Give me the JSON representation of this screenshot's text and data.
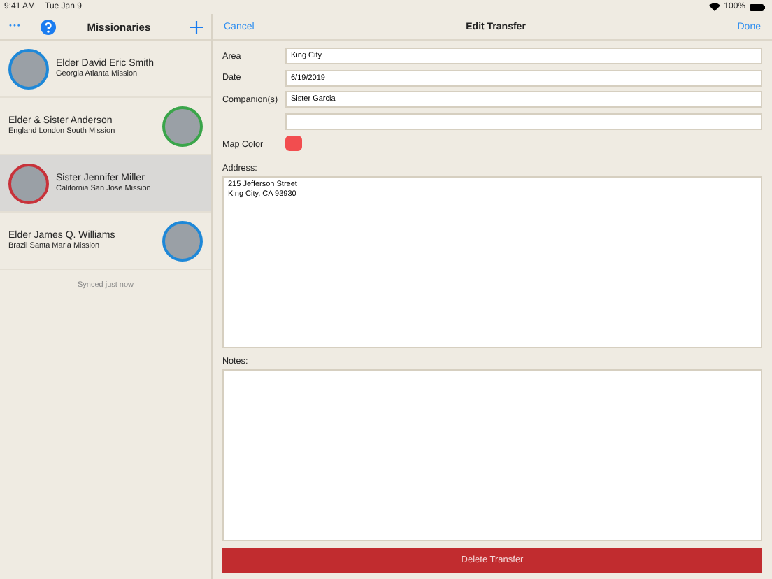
{
  "status_bar": {
    "time": "9:41 AM",
    "date": "Tue Jan 9",
    "battery": "100%"
  },
  "sidebar": {
    "title": "Missionaries",
    "more_icon": "•••",
    "items": [
      {
        "name": "Elder David Eric Smith",
        "mission": "Georgia Atlanta Mission",
        "kind": "left",
        "color": "#1e88d8",
        "selected": false
      },
      {
        "name": "Elder & Sister Anderson",
        "mission": "England London South Mission",
        "kind": "right",
        "color": "#3aa54a",
        "selected": false
      },
      {
        "name": "Sister Jennifer Miller",
        "mission": "California San Jose Mission",
        "kind": "left",
        "color": "#c8323a",
        "selected": true
      },
      {
        "name": "Elder James Q. Williams",
        "mission": "Brazil Santa Maria Mission",
        "kind": "right",
        "color": "#1e88d8",
        "selected": false
      }
    ],
    "sync_status": "Synced just now"
  },
  "editor": {
    "cancel": "Cancel",
    "title": "Edit Transfer",
    "done": "Done",
    "fields": [
      {
        "kind": "text",
        "label": "Area",
        "value": "King City"
      },
      {
        "kind": "text",
        "label": "Date",
        "value": "6/19/2019"
      },
      {
        "kind": "text",
        "label": "Companion(s)",
        "value": "Sister Garcia"
      },
      {
        "kind": "blank"
      }
    ],
    "map_color": {
      "label": "Map Color",
      "color": "#f24d4f"
    },
    "address": {
      "label": "Address:",
      "value": "215 Jefferson Street\nKing City, CA 93930"
    },
    "notes": {
      "label": "Notes:"
    },
    "delete_button": "Delete Transfer"
  }
}
